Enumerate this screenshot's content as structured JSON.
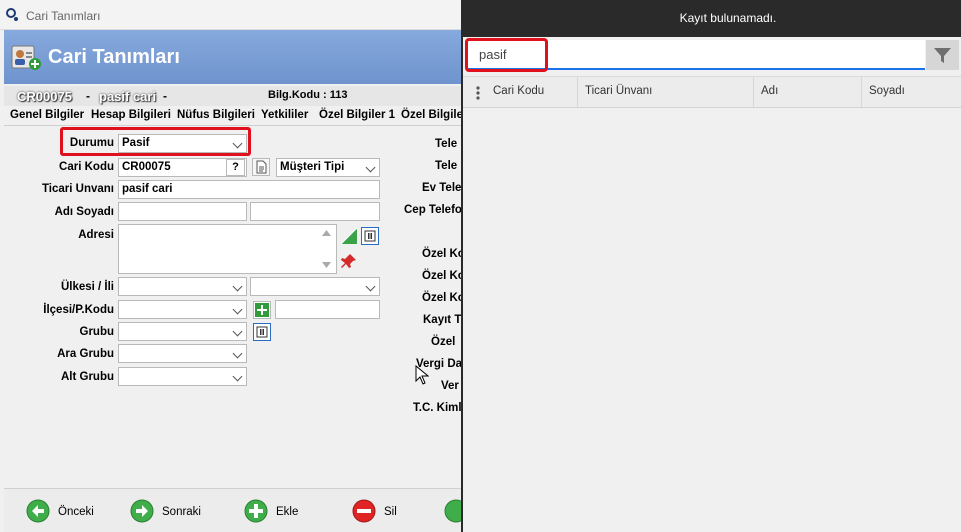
{
  "window": {
    "title": "Cari Tanımları"
  },
  "banner": {
    "title": "Cari Tanımları"
  },
  "record": {
    "code": "CR00075",
    "dash": "-",
    "name": "pasif cari",
    "dash2": "-",
    "bilg_kodu": "Bilg.Kodu : 113"
  },
  "tabs": [
    "Genel Bilgiler",
    "Hesap Bilgileri",
    "Nüfus Bilgileri",
    "Yetkililer",
    "Özel Bilgiler 1",
    "Özel Bilgile"
  ],
  "form": {
    "durumu_label": "Durumu",
    "durumu_value": "Pasif",
    "cari_kodu_label": "Cari Kodu",
    "cari_kodu_value": "CR00075",
    "question": "?",
    "musteri_tipi": "Müşteri Tipi",
    "ticari_unvani_label": "Ticari Unvanı",
    "ticari_unvani_value": "pasif cari",
    "adi_soyadi_label": "Adı Soyadı",
    "adresi_label": "Adresi",
    "ulkesi_label": "Ülkesi / İli",
    "ilcesi_label": "İlçesi/P.Kodu",
    "grubu_label": "Grubu",
    "ara_grubu_label": "Ara Grubu",
    "alt_grubu_label": "Alt Grubu"
  },
  "right_labels": [
    "Tele",
    "Tele",
    "Ev Tele",
    "Cep Telefo",
    "Özel Ko",
    "Özel Ko",
    "Özel Ko",
    "Kayıt T",
    "Özel",
    "Vergi Da",
    "Ver",
    "T.C. Kiml"
  ],
  "toolbar": {
    "prev": "Önceki",
    "next": "Sonraki",
    "add": "Ekle",
    "delete": "Sil"
  },
  "panel": {
    "message": "Kayıt bulunamadı.",
    "search_value": "pasif",
    "columns": [
      "Cari Kodu",
      "Ticari Ünvanı",
      "Adı",
      "Soyadı"
    ]
  },
  "colors": {
    "banner": "#7a9dd6",
    "highlight": "#e0101c",
    "accent": "#1a73e8"
  }
}
